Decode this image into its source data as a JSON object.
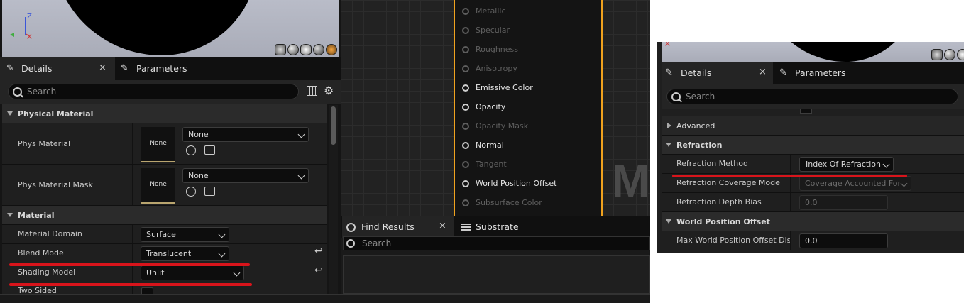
{
  "left": {
    "axis": {
      "z": "Z",
      "x": "X"
    },
    "tabs": {
      "details": "Details",
      "parameters": "Parameters"
    },
    "search_placeholder": "Search",
    "physical_material": {
      "header": "Physical Material",
      "phys_material": {
        "label": "Phys Material",
        "thumb": "None",
        "value": "None"
      },
      "phys_material_mask": {
        "label": "Phys Material Mask",
        "thumb": "None",
        "value": "None"
      }
    },
    "material": {
      "header": "Material",
      "domain": {
        "label": "Material Domain",
        "value": "Surface"
      },
      "blend": {
        "label": "Blend Mode",
        "value": "Translucent"
      },
      "shading": {
        "label": "Shading Model",
        "value": "Unlit"
      },
      "two_sided": {
        "label": "Two Sided"
      }
    }
  },
  "graph": {
    "pins": [
      "Metallic",
      "Specular",
      "Roughness",
      "Anisotropy",
      "Emissive Color",
      "Opacity",
      "Opacity Mask",
      "Normal",
      "Tangent",
      "World Position Offset",
      "Subsurface Color"
    ],
    "watermark": "MA"
  },
  "find": {
    "tabs": {
      "find_results": "Find Results",
      "substrate": "Substrate"
    },
    "search_placeholder": "Search"
  },
  "right": {
    "axis": {
      "x": "X"
    },
    "tabs": {
      "details": "Details",
      "parameters": "Parameters"
    },
    "search_placeholder": "Search",
    "advanced": "Advanced",
    "refraction": {
      "header": "Refraction",
      "method": {
        "label": "Refraction Method",
        "value": "Index Of Refraction"
      },
      "coverage": {
        "label": "Refraction Coverage Mode",
        "value": "Coverage Accounted For"
      },
      "depth_bias": {
        "label": "Refraction Depth Bias",
        "value": "0.0"
      }
    },
    "wpo": {
      "header": "World Position Offset",
      "max_disp": {
        "label": "Max World Position Offset Dis...",
        "value": "0.0"
      }
    }
  },
  "colors": {
    "accent_orange": "#f0a21e",
    "annotation_red": "#d8141b"
  }
}
